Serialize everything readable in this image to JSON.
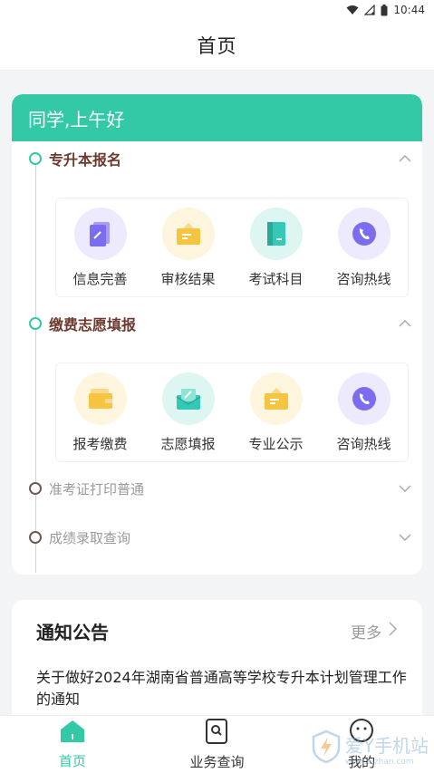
{
  "status_bar": {
    "time": "10:44",
    "icons": [
      "wifi-icon",
      "signal-icon",
      "battery-icon"
    ]
  },
  "header": {
    "title": "首页"
  },
  "greeting": "同学,上午好",
  "sections": [
    {
      "title": "专升本报名",
      "expanded": true,
      "items": [
        {
          "label": "信息完善",
          "icon": "document-edit-icon",
          "color": "#7c6cf0",
          "bg": "#eeeafd"
        },
        {
          "label": "审核结果",
          "icon": "folder-check-icon",
          "color": "#f5c542",
          "bg": "#fdf5dd"
        },
        {
          "label": "考试科目",
          "icon": "book-icon",
          "color": "#33c9b6",
          "bg": "#ddf6f2"
        },
        {
          "label": "咨询热线",
          "icon": "phone-icon",
          "color": "#7c6cf0",
          "bg": "#eeeafd"
        }
      ]
    },
    {
      "title": "缴费志愿填报",
      "expanded": true,
      "items": [
        {
          "label": "报考缴费",
          "icon": "wallet-icon",
          "color": "#f5c542",
          "bg": "#fdf5dd"
        },
        {
          "label": "志愿填报",
          "icon": "envelope-edit-icon",
          "color": "#33c9b6",
          "bg": "#ddf6f2"
        },
        {
          "label": "专业公示",
          "icon": "folder-check-icon",
          "color": "#f5c542",
          "bg": "#fdf5dd"
        },
        {
          "label": "咨询热线",
          "icon": "phone-icon",
          "color": "#7c6cf0",
          "bg": "#eeeafd"
        }
      ]
    },
    {
      "title": "准考证打印普通",
      "expanded": false
    },
    {
      "title": "成绩录取查询",
      "expanded": false
    }
  ],
  "notice": {
    "title": "通知公告",
    "more": "更多",
    "items": [
      "关于做好2024年湖南省普通高等学校专升本计划管理工作的通知"
    ]
  },
  "tabs": [
    {
      "label": "首页",
      "icon": "home-icon",
      "active": true
    },
    {
      "label": "业务查询",
      "icon": "search-doc-icon",
      "active": false
    },
    {
      "label": "我的",
      "icon": "user-icon",
      "active": false
    }
  ],
  "watermark": {
    "text": "爱Y手机站",
    "sub": "www.aizhan.com"
  },
  "colors": {
    "accent": "#33c9a6",
    "section_title": "#6f3a2e"
  }
}
